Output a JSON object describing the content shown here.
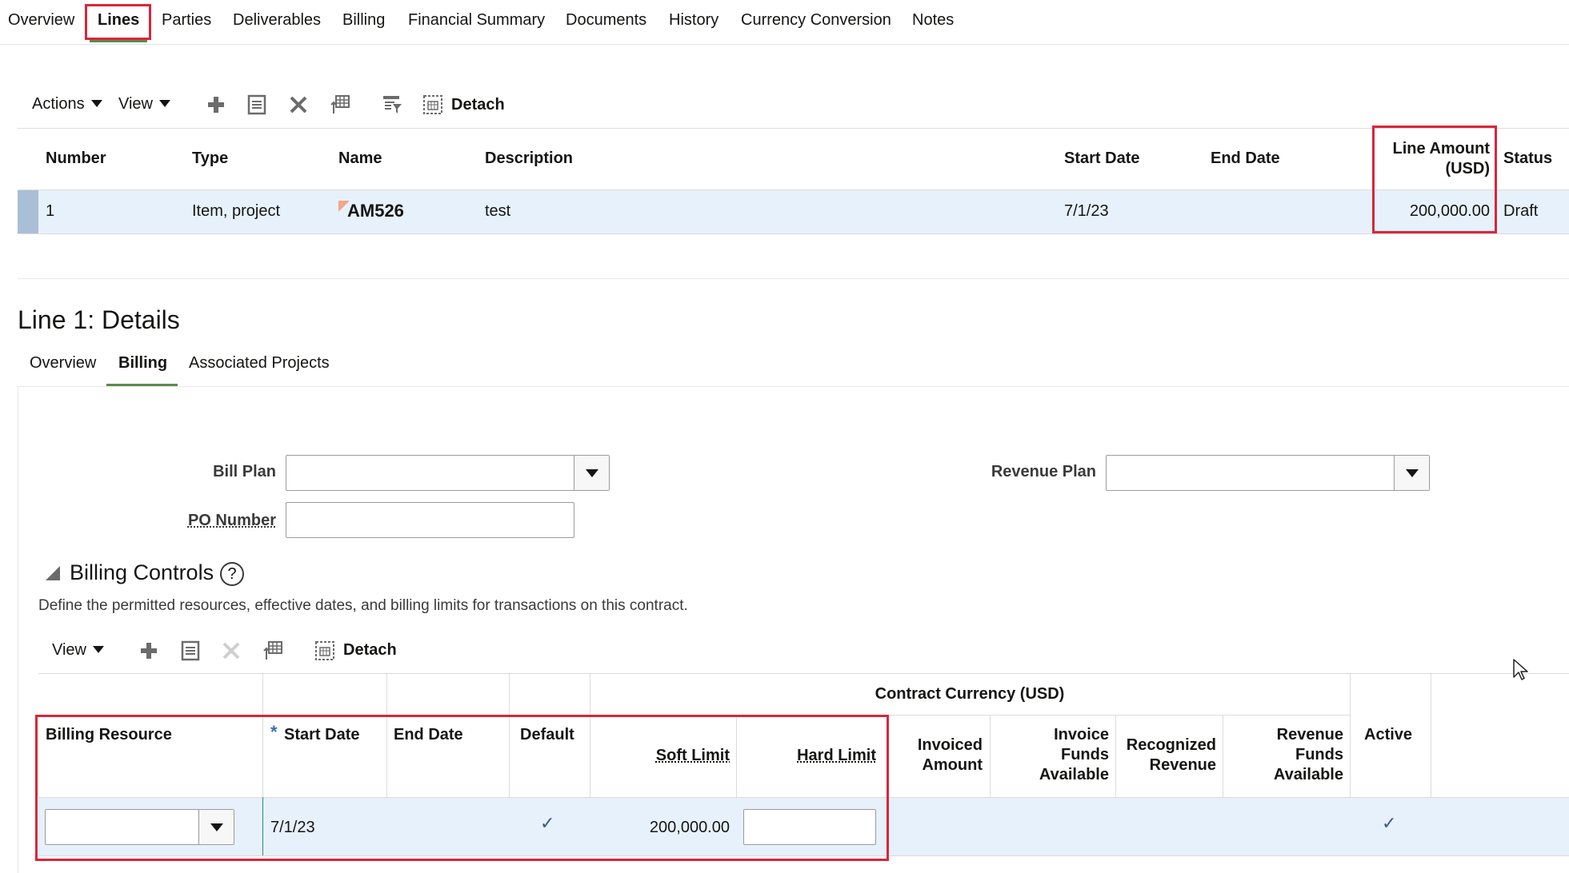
{
  "top_tabs": [
    {
      "label": "Overview"
    },
    {
      "label": "Lines"
    },
    {
      "label": "Parties"
    },
    {
      "label": "Deliverables"
    },
    {
      "label": "Billing"
    },
    {
      "label": "Financial Summary"
    },
    {
      "label": "Documents"
    },
    {
      "label": "History"
    },
    {
      "label": "Currency Conversion"
    },
    {
      "label": "Notes"
    }
  ],
  "lines_toolbar": {
    "actions_label": "Actions",
    "view_label": "View",
    "detach_label": "Detach"
  },
  "lines_table": {
    "headers": {
      "number": "Number",
      "type": "Type",
      "name": "Name",
      "description": "Description",
      "start_date": "Start Date",
      "end_date": "End Date",
      "line_amount_1": "Line Amount",
      "line_amount_2": "(USD)",
      "status": "Status"
    },
    "row": {
      "number": "1",
      "type": "Item, project",
      "name": "AM526",
      "description": "test",
      "start_date": "7/1/23",
      "end_date": "",
      "line_amount": "200,000.00",
      "status": "Draft"
    }
  },
  "details": {
    "title": "Line 1: Details",
    "tabs": [
      {
        "label": "Overview"
      },
      {
        "label": "Billing"
      },
      {
        "label": "Associated Projects"
      }
    ],
    "bill_plan_label": "Bill Plan",
    "po_number_label": "PO Number",
    "revenue_plan_label": "Revenue Plan",
    "bill_plan_value": "",
    "po_number_value": "",
    "revenue_plan_value": ""
  },
  "billing_controls": {
    "title": "Billing Controls",
    "help_glyph": "?",
    "description": "Define the permitted resources, effective dates, and billing limits for transactions on this contract.",
    "toolbar": {
      "view_label": "View",
      "detach_label": "Detach"
    },
    "group_header": "Contract Currency (USD)",
    "headers": {
      "billing_resource": "Billing Resource",
      "required_mark": "*",
      "start_date": "Start Date",
      "end_date": "End Date",
      "default": "Default",
      "soft_limit": "Soft Limit",
      "hard_limit": "Hard Limit",
      "invoiced_1": "Invoiced",
      "invoiced_2": "Amount",
      "invoice_funds_1": "Invoice",
      "invoice_funds_2": "Funds",
      "invoice_funds_3": "Available",
      "recognized_1": "Recognized",
      "recognized_2": "Revenue",
      "revenue_funds_1": "Revenue",
      "revenue_funds_2": "Funds",
      "revenue_funds_3": "Available",
      "active": "Active"
    },
    "row": {
      "billing_resource": "",
      "start_date": "7/1/23",
      "end_date": "",
      "default_check": "✓",
      "soft_limit": "200,000.00",
      "hard_limit": "",
      "active_check": "✓"
    }
  },
  "colors": {
    "highlight": "#d9263a",
    "selected_row": "#e7f1fb",
    "active_tab_underline": "#5b8a50"
  }
}
